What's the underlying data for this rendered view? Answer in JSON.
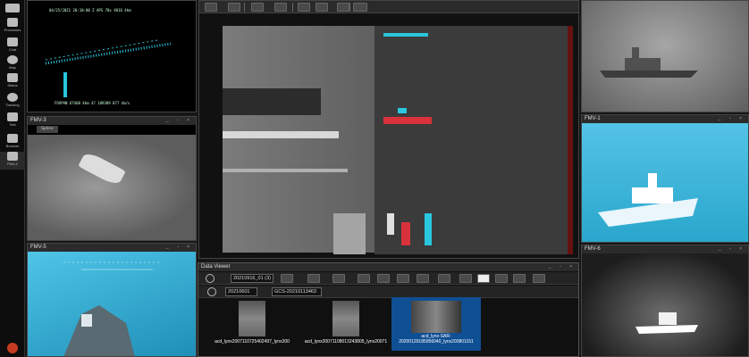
{
  "nav": {
    "items": [
      {
        "label": "Processes",
        "icon": "gears-icon"
      },
      {
        "label": "Chat",
        "icon": "chat-icon"
      },
      {
        "label": "Map",
        "icon": "globe-icon"
      },
      {
        "label": "Status",
        "icon": "status-icon"
      },
      {
        "label": "Tracking",
        "icon": "target-icon"
      },
      {
        "label": "Test",
        "icon": "test-icon"
      },
      {
        "label": "Browser",
        "icon": "binoculars-icon"
      },
      {
        "label": "FMV-2",
        "icon": "monitor-icon"
      }
    ]
  },
  "panels": {
    "top_left": {
      "overlay_top": "04/25/2021 20:10:00 Z APS 78x 4016 4km",
      "overlay_bottom": "FOVPAN 67468 4km 47 189389 877 4m/s"
    },
    "fmv3": {
      "title": "FMV-3",
      "tab": "Spline"
    },
    "fmv5": {
      "title": "FMV-5"
    },
    "fmv1": {
      "title": "FMV-1"
    },
    "fmv6": {
      "title": "FMV-6"
    },
    "controls": "_ ▫ ×"
  },
  "data_viewer": {
    "title": "Data Viewer",
    "search_value": "20210916_01 (3)",
    "filter1": "20210601",
    "filter2": "GCS-20210113463",
    "thumbnails": [
      {
        "caption": "acd_lynx2007110725402497_lynx200"
      },
      {
        "caption": "acd_lynx20071108013243805_lynx20071"
      },
      {
        "caption": "acd_lynx-SAR-20200129185956040_lynx200801151"
      }
    ]
  },
  "colors": {
    "accent": "#1e6fd0",
    "cyan": "#29c6de",
    "sea": "#2aa6cc"
  }
}
